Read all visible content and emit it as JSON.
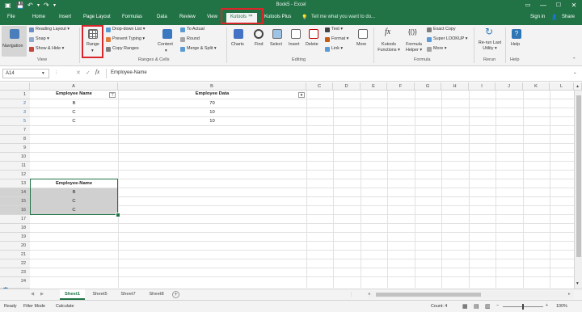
{
  "window": {
    "title": "Book5 - Excel",
    "signin": "Sign in",
    "share": "Share"
  },
  "tabs": [
    "File",
    "Home",
    "Insert",
    "Page Layout",
    "Formulas",
    "Data",
    "Review",
    "View",
    "Kutools ™",
    "Kutools Plus"
  ],
  "tell_me": "Tell me what you want to do...",
  "ribbon": {
    "navigation": "Navigation",
    "view_items": [
      "Reading Layout ▾",
      "Snap ▾",
      "Show & Hide ▾"
    ],
    "view_group": "View",
    "range": "Range",
    "range_items": [
      "Drop-down List ▾",
      "Prevent Typing ▾",
      "Copy Ranges"
    ],
    "content": "Content",
    "content_items": [
      "To Actual",
      "Round",
      "Merge & Split ▾"
    ],
    "ranges_group": "Ranges & Cells",
    "editing_big": [
      "Charts",
      "Find",
      "Select",
      "Insert",
      "Delete"
    ],
    "editing_items": [
      "Text ▾",
      "Format ▾",
      "Link ▾"
    ],
    "more": "More",
    "editing_group": "Editing",
    "formula_big": [
      "Kutools Functions ▾",
      "Formula Helper ▾"
    ],
    "formula_items": [
      "Exact Copy",
      "Super LOOKUP ▾",
      "More ▾"
    ],
    "formula_group": "Formula",
    "rerun": "Re-run Last Utility ▾",
    "rerun_group": "Rerun",
    "help": "Help",
    "help_group": "Help"
  },
  "formula_bar": {
    "name_box": "A14",
    "fx": "fx",
    "value": "Employee-Name"
  },
  "columns": [
    "A",
    "B",
    "C",
    "D",
    "E",
    "F",
    "G",
    "H",
    "I",
    "J",
    "K",
    "L"
  ],
  "rows": [
    "1",
    "2",
    "3",
    "5",
    "7",
    "8",
    "9",
    "10",
    "11",
    "12",
    "13",
    "14",
    "15",
    "16",
    "17",
    "18",
    "19",
    "20",
    "21",
    "22",
    "23",
    "24",
    "25",
    "26",
    "27"
  ],
  "cells": {
    "a1": "Employee Name",
    "b1": "Employee Data",
    "a2": "B",
    "b2": "70",
    "a3": "C",
    "b3": "10",
    "a5": "C",
    "b5": "10",
    "a14": "Employee-Name",
    "a15": "B",
    "a16": "C",
    "a17": "C"
  },
  "sheets": [
    "Sheet1",
    "Sheet5",
    "Sheet7",
    "Sheet8"
  ],
  "status": {
    "ready": "Ready",
    "filter_mode": "Filter Mode",
    "calculate": "Calculate",
    "count": "Count: 4",
    "zoom": "100%"
  },
  "colors": {
    "brand": "#217346",
    "highlight": "#d9262b",
    "selection": "#d0d0d0"
  }
}
